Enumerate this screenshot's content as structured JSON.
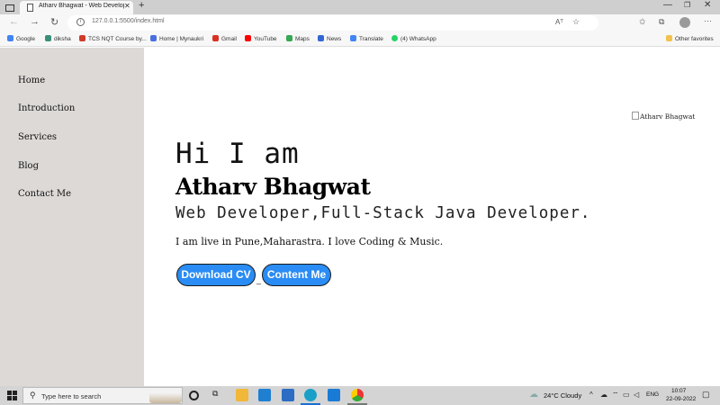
{
  "browser": {
    "tab_title": "Atharv Bhagwat - Web Develope",
    "url": "127.0.0.1:5500/index.html",
    "read_aloud": "Aᵀ"
  },
  "bookmarks": [
    {
      "label": "Google",
      "icon": "google-icon",
      "color": "#4285f4"
    },
    {
      "label": "diksha",
      "icon": "diksha-icon",
      "color": "#3b8f7a"
    },
    {
      "label": "TCS NQT Course by...",
      "icon": "tcs-icon",
      "color": "#cf3b2a"
    },
    {
      "label": "Home | Mynaukri",
      "icon": "naukri-icon",
      "color": "#4a6ee0"
    },
    {
      "label": "Gmail",
      "icon": "gmail-icon",
      "color": "#d93025"
    },
    {
      "label": "YouTube",
      "icon": "youtube-icon",
      "color": "#ff0000"
    },
    {
      "label": "Maps",
      "icon": "maps-icon",
      "color": "#34a853"
    },
    {
      "label": "News",
      "icon": "news-icon",
      "color": "#3367d6"
    },
    {
      "label": "Translate",
      "icon": "translate-icon",
      "color": "#4285f4"
    },
    {
      "label": "(4) WhatsApp",
      "icon": "whatsapp-icon",
      "color": "#25d366"
    }
  ],
  "other_favorites": "Other favorites",
  "sidebar": {
    "items": [
      {
        "label": "Home"
      },
      {
        "label": "Introduction"
      },
      {
        "label": "Services"
      },
      {
        "label": "Blog"
      },
      {
        "label": "Contact Me"
      }
    ]
  },
  "hero": {
    "image_alt": "Atharv Bhagwat",
    "greeting": "Hi I am",
    "name": "Atharv Bhagwat",
    "roles": "Web Developer,Full-Stack Java Developer.",
    "bio": "I am live in Pune,Maharastra. I love Coding & Music.",
    "download_label": "Download CV",
    "separator": "_",
    "contact_label": "Content Me",
    "accent_color": "#2a8cf4"
  },
  "taskbar": {
    "search_placeholder": "Type here to search",
    "weather": "24°C  Cloudy",
    "language": "ENG",
    "time": "10:07",
    "date": "22-09-2022"
  }
}
